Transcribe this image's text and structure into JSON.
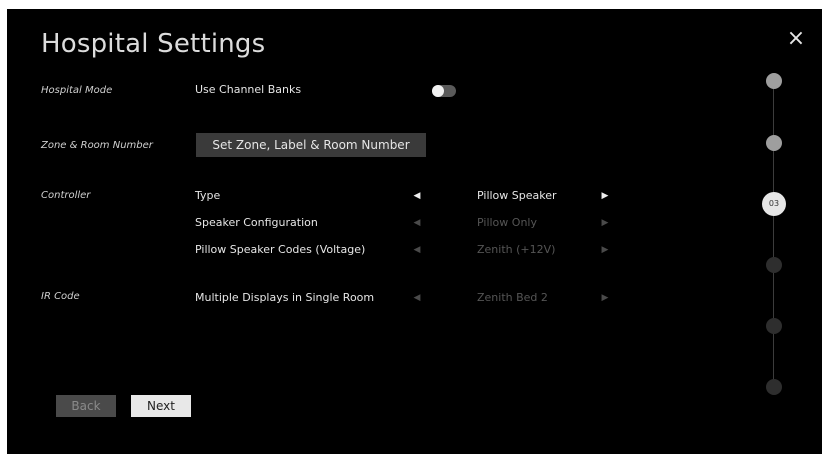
{
  "title": "Hospital Settings",
  "close_icon": "×",
  "sections": {
    "hospital_mode": {
      "label": "Hospital Mode",
      "row_label": "Use Channel Banks",
      "toggle_on": false
    },
    "zone": {
      "label": "Zone & Room Number",
      "button_label": "Set Zone, Label & Room Number"
    },
    "controller": {
      "label": "Controller",
      "rows": [
        {
          "label": "Type",
          "value": "Pillow Speaker",
          "enabled": true
        },
        {
          "label": "Speaker Configuration",
          "value": "Pillow Only",
          "enabled": false
        },
        {
          "label": "Pillow Speaker Codes (Voltage)",
          "value": "Zenith (+12V)",
          "enabled": false
        }
      ]
    },
    "ir_code": {
      "label": "IR Code",
      "rows": [
        {
          "label": "Multiple Displays in Single Room",
          "value": "Zenith Bed 2",
          "enabled": false
        }
      ]
    }
  },
  "arrows": {
    "left": "◀",
    "right": "▶"
  },
  "buttons": {
    "back": "Back",
    "next": "Next"
  },
  "stepper": {
    "current_label": "03",
    "current_index": 3,
    "total_steps": 6
  },
  "colors": {
    "background": "#000000",
    "text": "#e6e6e6",
    "disabled": "#555555",
    "step_done": "#9e9e9e",
    "step_todo": "#2e2e2e"
  }
}
